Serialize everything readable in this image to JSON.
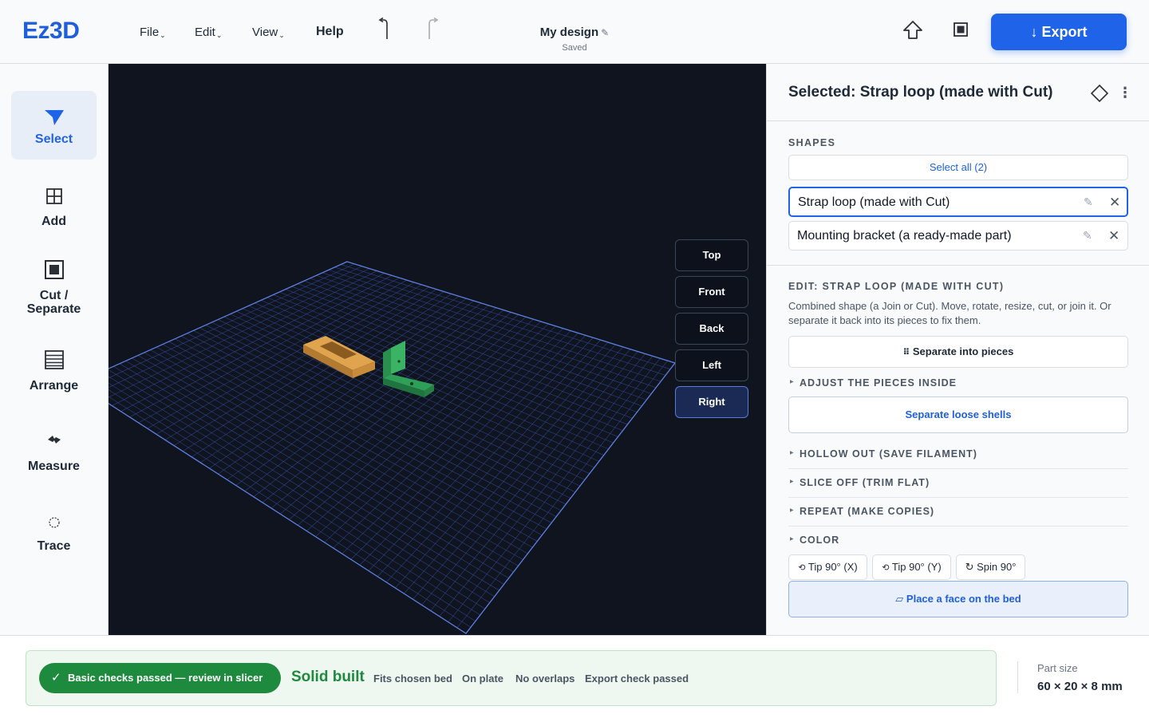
{
  "app": {
    "logo": "Ez3D"
  },
  "menus": {
    "file": "File",
    "edit": "Edit",
    "view": "View",
    "help": "Help",
    "chevron": "⌄"
  },
  "document": {
    "title": "My design",
    "status": "Saved"
  },
  "export": {
    "label": "Export",
    "arrow": "↓"
  },
  "tools": [
    {
      "label": "Select",
      "icon": "select-arrow-icon"
    },
    {
      "label": "Add",
      "icon": "add-grid-icon"
    },
    {
      "label": "Cut /\nSeparate",
      "icon": "cut-square-icon"
    },
    {
      "label": "Arrange",
      "icon": "arrange-lines-icon"
    },
    {
      "label": "Measure",
      "icon": "measure-icon"
    },
    {
      "label": "Trace",
      "icon": "trace-icon"
    }
  ],
  "viewport": {
    "views": [
      "Top",
      "Front",
      "Back",
      "Left",
      "Right"
    ],
    "active_view": "Right",
    "colors": {
      "background": "#0f141f",
      "grid": "#3550a8",
      "strap": "#d89a44",
      "bracket": "#2f9e57"
    }
  },
  "panel": {
    "selected_title": "Selected: Strap loop (made with Cut)",
    "shapes_label": "SHAPES",
    "select_all": "Select all (2)",
    "shapes": [
      {
        "name": "Strap loop (made with Cut)",
        "selected": true
      },
      {
        "name": "Mounting bracket (a ready-made part)",
        "selected": false
      }
    ],
    "edit_label": "EDIT: STRAP LOOP (MADE WITH CUT)",
    "description": "Combined shape (a Join or Cut). Move, rotate, resize, cut, or join it. Or separate it back into its pieces to fix them.",
    "separate_pieces": "Separate into pieces",
    "adjust_label": "ADJUST THE PIECES INSIDE",
    "separate_shells": "Separate loose shells",
    "sections": [
      "HOLLOW OUT (SAVE FILAMENT)",
      "SLICE OFF (TRIM FLAT)",
      "REPEAT (MAKE COPIES)",
      "COLOR"
    ],
    "rotate_buttons": [
      "Tip 90° (X)",
      "Tip 90° (Y)",
      "Spin 90°"
    ],
    "place_face": "Place a face on the bed"
  },
  "status": {
    "pill": "Basic checks passed — review in slicer",
    "solid": "Solid built",
    "checks": [
      "Fits chosen bed",
      "On plate",
      "No overlaps",
      "Export check passed"
    ],
    "part_size_label": "Part size",
    "part_size_value": "60 × 20 × 8 mm"
  },
  "colors": {
    "accent": "#1f63e9",
    "success": "#1e8a3e"
  }
}
